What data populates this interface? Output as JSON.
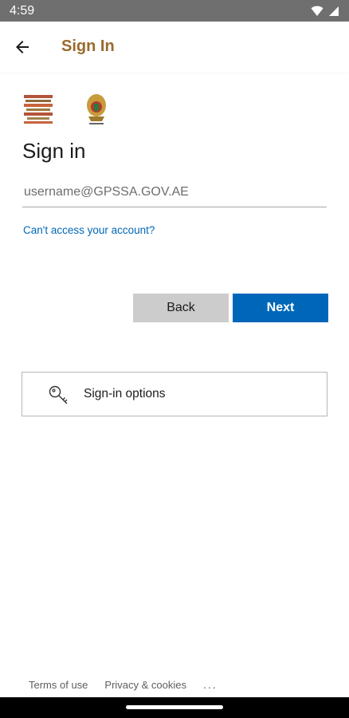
{
  "status_bar": {
    "time": "4:59"
  },
  "app_bar": {
    "title": "Sign In"
  },
  "main": {
    "heading": "Sign in",
    "email_placeholder": "username@GPSSA.GOV.AE",
    "cant_access": "Can't access your account?",
    "back_label": "Back",
    "next_label": "Next",
    "signin_options_label": "Sign-in options"
  },
  "footer": {
    "terms": "Terms of use",
    "privacy": "Privacy & cookies",
    "more": "..."
  },
  "colors": {
    "accent": "#0067b8",
    "brand_title": "#9a6a2c",
    "status_bar": "#6f6f6f"
  },
  "icons": [
    "back-arrow-icon",
    "wifi-icon",
    "signal-icon",
    "key-icon"
  ]
}
